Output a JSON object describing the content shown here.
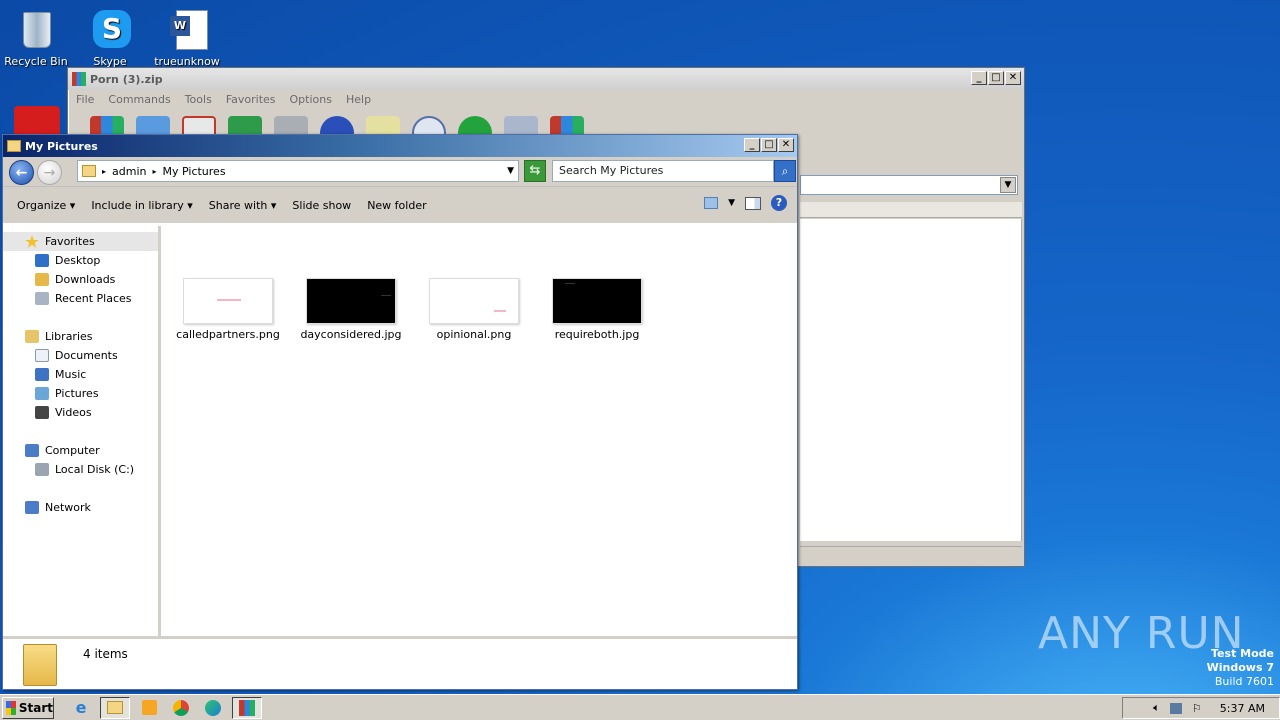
{
  "desktop": {
    "icons": [
      {
        "label": "Recycle Bin",
        "icon": "recycle-bin-icon"
      },
      {
        "label": "Skype",
        "icon": "skype-icon"
      },
      {
        "label": "trueunknow",
        "icon": "word-document-icon"
      }
    ]
  },
  "winrar": {
    "title": "Porn (3).zip",
    "menu": [
      "File",
      "Commands",
      "Tools",
      "Favorites",
      "Options",
      "Help"
    ]
  },
  "explorer": {
    "title": "My Pictures",
    "breadcrumb": [
      "admin",
      "My Pictures"
    ],
    "search_placeholder": "Search My Pictures",
    "commands": [
      "Organize",
      "Include in library",
      "Share with",
      "Slide show",
      "New folder"
    ],
    "nav": {
      "favorites_label": "Favorites",
      "favorites": [
        "Desktop",
        "Downloads",
        "Recent Places"
      ],
      "libraries_label": "Libraries",
      "libraries": [
        "Documents",
        "Music",
        "Pictures",
        "Videos"
      ],
      "computer_label": "Computer",
      "computer": [
        "Local Disk (C:)"
      ],
      "network_label": "Network"
    },
    "files": [
      {
        "name": "calledpartners.png",
        "thumb": "white"
      },
      {
        "name": "dayconsidered.jpg",
        "thumb": "black"
      },
      {
        "name": "opinional.png",
        "thumb": "white"
      },
      {
        "name": "requireboth.jpg",
        "thumb": "black"
      }
    ],
    "status": "4 items"
  },
  "watermark": "ANY RUN",
  "testmode": {
    "line1": "Test Mode",
    "line2": "Windows 7",
    "line3": "Build 7601"
  },
  "taskbar": {
    "start": "Start",
    "clock": "5:37 AM"
  }
}
